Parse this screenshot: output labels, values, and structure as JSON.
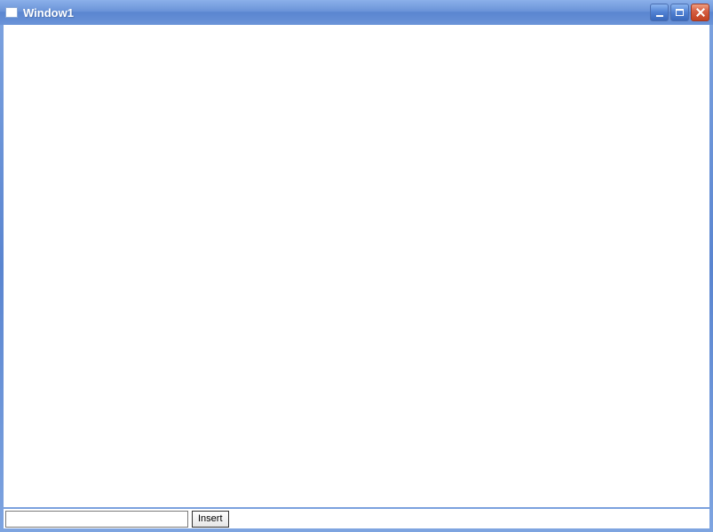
{
  "titlebar": {
    "title": "Window1"
  },
  "footer": {
    "input_value": "",
    "insert_label": "Insert"
  }
}
